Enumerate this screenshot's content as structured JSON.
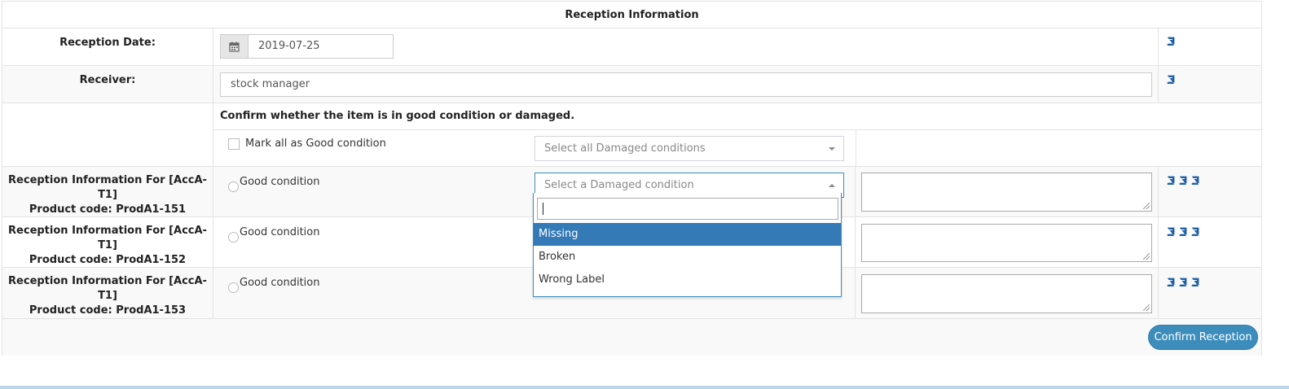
{
  "header": {
    "title": "Reception Information"
  },
  "reception_date": {
    "label": "Reception Date:",
    "value": "2019-07-25",
    "icon": "calendar-icon"
  },
  "receiver": {
    "label": "Receiver:",
    "value": "stock manager"
  },
  "condition_section": {
    "instruction": "Confirm whether the item is in good condition or damaged.",
    "mark_all_label": "Mark all as Good condition",
    "select_all_placeholder": "Select all Damaged conditions"
  },
  "items": [
    {
      "title": "Reception Information For [AccA-T1]",
      "product_code": "Product code: ProdA1-151",
      "good_label": "Good condition",
      "damaged_placeholder": "Select a Damaged condition"
    },
    {
      "title": "Reception Information For [AccA-T1]",
      "product_code": "Product code: ProdA1-152",
      "good_label": "Good condition"
    },
    {
      "title": "Reception Information For [AccA-T1]",
      "product_code": "Product code: ProdA1-153",
      "good_label": "Good condition"
    }
  ],
  "dropdown": {
    "search_value": "",
    "options": [
      "Missing",
      "Broken",
      "Wrong Label"
    ],
    "highlighted": "Missing"
  },
  "footer": {
    "confirm_label": "Confirm Reception"
  },
  "colors": {
    "primary": "#3c8dbc",
    "highlight": "#337ab7",
    "book_icon": "#1f5fa8"
  }
}
